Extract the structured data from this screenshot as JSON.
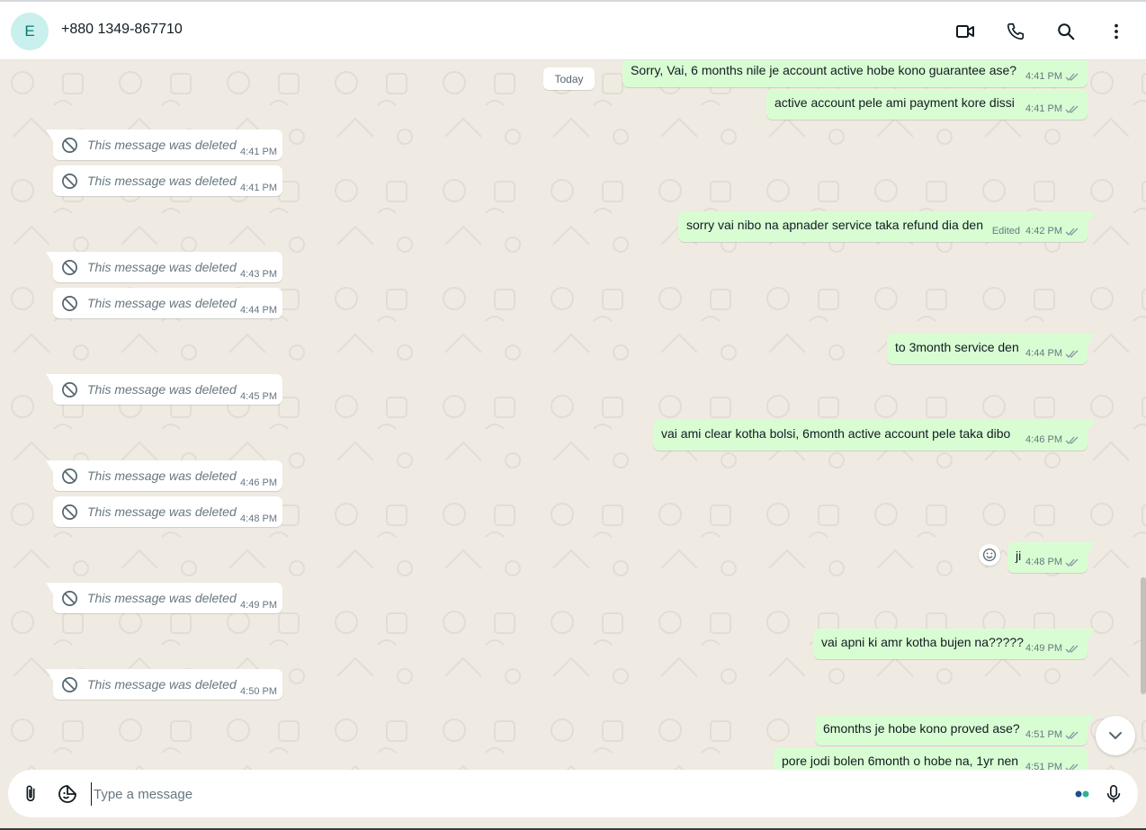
{
  "header": {
    "avatar_letter": "E",
    "contact_name": "+880 1349-867710",
    "icons": [
      "video-call-icon",
      "voice-call-icon",
      "search-icon",
      "menu-icon"
    ]
  },
  "chat": {
    "date_label": "Today",
    "deleted_text": "This message was deleted",
    "incoming": [
      {
        "text": "This message was deleted",
        "time": "4:41 PM"
      },
      {
        "text": "This message was deleted",
        "time": "4:41 PM"
      },
      {
        "text": "This message was deleted",
        "time": "4:43 PM"
      },
      {
        "text": "This message was deleted",
        "time": "4:44 PM"
      },
      {
        "text": "This message was deleted",
        "time": "4:45 PM"
      },
      {
        "text": "This message was deleted",
        "time": "4:46 PM"
      },
      {
        "text": "This message was deleted",
        "time": "4:48 PM"
      },
      {
        "text": "This message was deleted",
        "time": "4:49 PM"
      },
      {
        "text": "This message was deleted",
        "time": "4:50 PM"
      }
    ],
    "outgoing": [
      {
        "text": "Sorry, Vai, 6 months nile je account active hobe kono guarantee ase?",
        "time": "4:41 PM"
      },
      {
        "text": "active account pele ami payment kore dissi",
        "time": "4:41 PM"
      },
      {
        "text": "sorry vai nibo na apnader service taka refund dia den",
        "time": "4:42 PM",
        "edited": "Edited"
      },
      {
        "text": "to 3month service den",
        "time": "4:44 PM"
      },
      {
        "text": "vai ami clear kotha bolsi, 6month active account pele taka dibo",
        "time": "4:46 PM"
      },
      {
        "text": "ji",
        "time": "4:48 PM"
      },
      {
        "text": "vai apni ki amr kotha bujen na?????",
        "time": "4:49 PM"
      },
      {
        "text": "6months je hobe kono proved ase?",
        "time": "4:51 PM"
      },
      {
        "text": "pore jodi bolen 6month o hobe na, 1yr nen",
        "time": "4:51 PM"
      }
    ]
  },
  "composer": {
    "placeholder": "Type a message",
    "icons": [
      "attach-icon",
      "sticker-icon",
      "meta-ai-icon",
      "microphone-icon"
    ]
  },
  "colors": {
    "outgoing_bubble": "#d9fdd3",
    "incoming_bubble": "#ffffff",
    "chat_background": "#efeae2",
    "avatar_bg": "#c9f0ec"
  }
}
